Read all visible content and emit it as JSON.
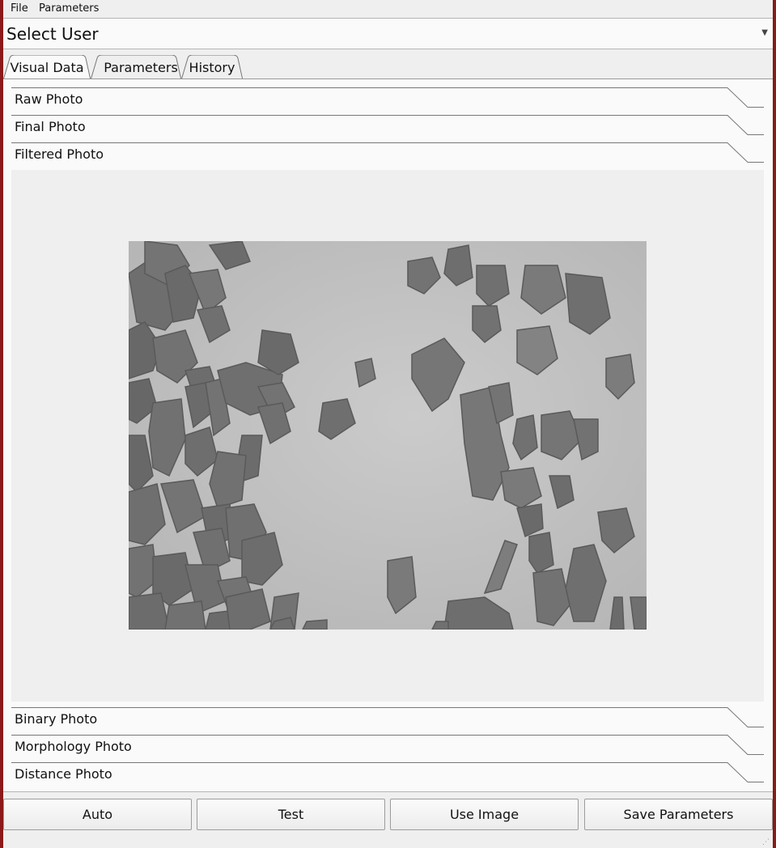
{
  "menu": {
    "file": "File",
    "parameters": "Parameters"
  },
  "user_select": {
    "value": "Select User"
  },
  "tabs": [
    {
      "label": "Visual Data",
      "selected": true
    },
    {
      "label": "Parameters",
      "selected": false
    },
    {
      "label": "History",
      "selected": false
    }
  ],
  "expanders": {
    "raw": "Raw Photo",
    "final": "Final Photo",
    "filtered": "Filtered Photo",
    "binary": "Binary Photo",
    "morphology": "Morphology Photo",
    "distance": "Distance Photo"
  },
  "buttons": {
    "auto": "Auto",
    "test": "Test",
    "use_image": "Use Image",
    "save_parameters": "Save Parameters"
  },
  "colors": {
    "frame": "#8b1a1a",
    "panel": "#fafafa",
    "window": "#efefef"
  }
}
